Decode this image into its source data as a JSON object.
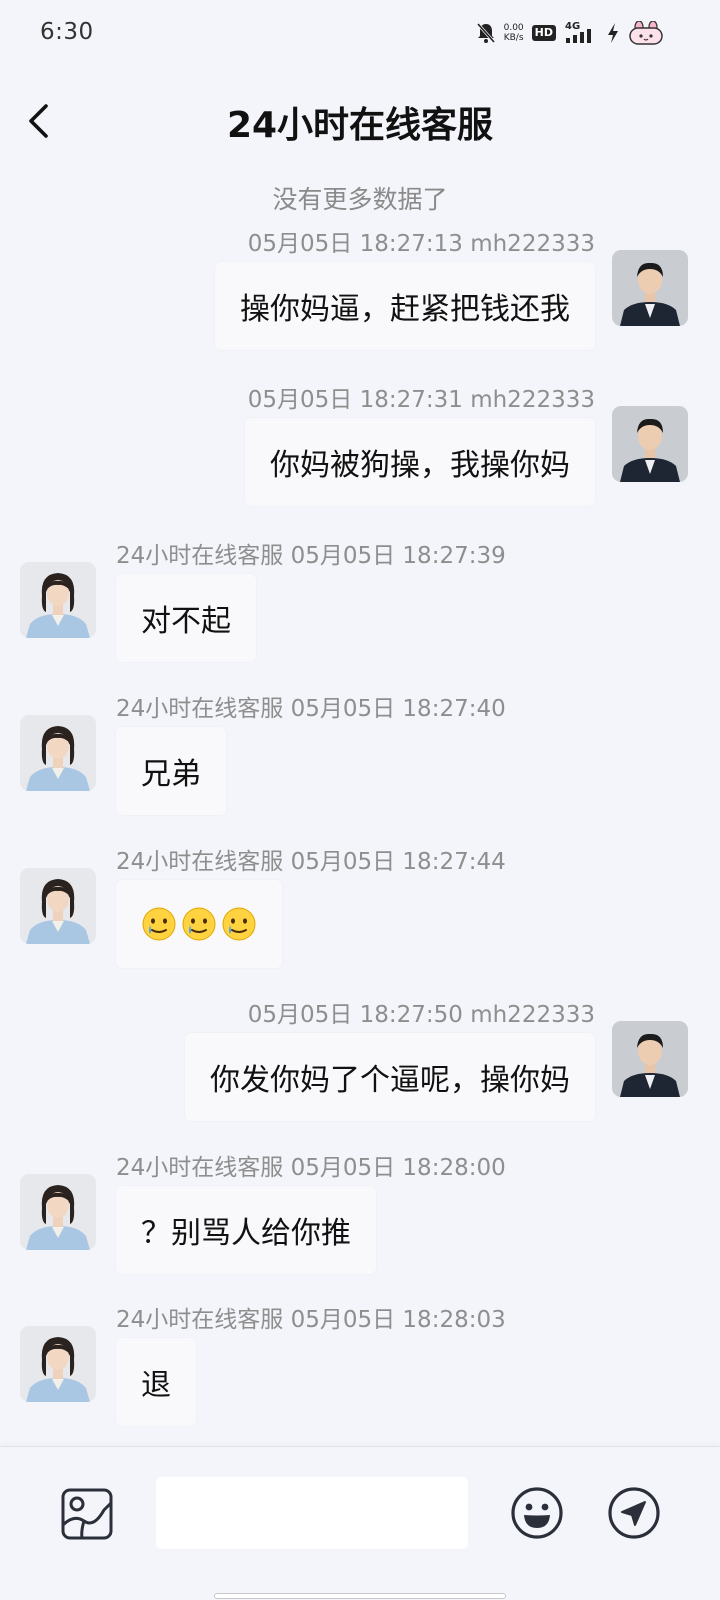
{
  "status_bar": {
    "time": "6:30",
    "speed_value": "0.00",
    "speed_unit": "KB/s",
    "hd": "HD",
    "network": "4G"
  },
  "header": {
    "title": "24小时在线客服"
  },
  "no_more": "没有更多数据了",
  "messages": [
    {
      "side": "out",
      "meta": "05月05日 18:27:13 mh222333",
      "text": "操你妈逼，赶紧把钱还我"
    },
    {
      "side": "out",
      "meta": "05月05日 18:27:31 mh222333",
      "text": "你妈被狗操，我操你妈"
    },
    {
      "side": "in",
      "meta": "24小时在线客服 05月05日 18:27:39",
      "text": "对不起"
    },
    {
      "side": "in",
      "meta": "24小时在线客服 05月05日 18:27:40",
      "text": "兄弟"
    },
    {
      "side": "in",
      "meta": "24小时在线客服 05月05日 18:27:44",
      "emojis": [
        "crying-smile-emoji",
        "crying-smile-emoji",
        "crying-smile-emoji"
      ]
    },
    {
      "side": "out",
      "meta": "05月05日 18:27:50 mh222333",
      "text": "你发你妈了个逼呢，操你妈"
    },
    {
      "side": "in",
      "meta": "24小时在线客服 05月05日 18:28:00",
      "text": "？别骂人给你推"
    },
    {
      "side": "in",
      "meta": "24小时在线客服 05月05日 18:28:03",
      "text": "退"
    }
  ],
  "composer": {
    "input_value": "",
    "image_icon": "image-icon",
    "emoji_icon": "emoji-icon",
    "send_icon": "send-icon"
  },
  "colors": {
    "background": "#f4f5fa",
    "bubble": "#f9f9fb",
    "meta_text": "#8e8e8e"
  }
}
